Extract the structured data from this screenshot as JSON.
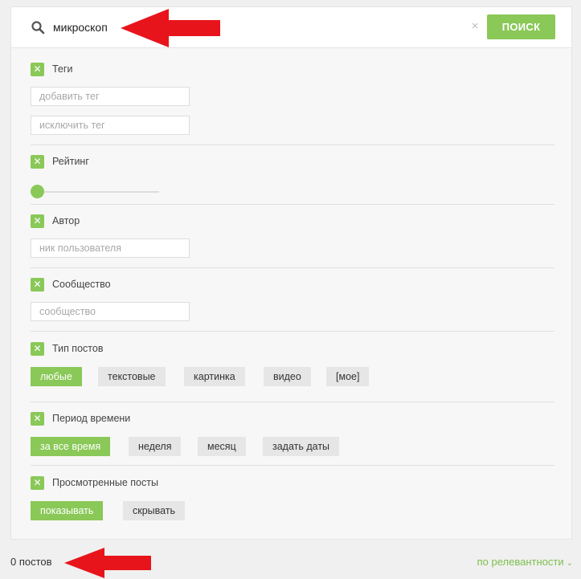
{
  "search": {
    "value": "микроскоп",
    "clear_glyph": "×",
    "button_label": "ПОИСК"
  },
  "filters": {
    "tags": {
      "label": "Теги",
      "include_placeholder": "добавить тег",
      "exclude_placeholder": "исключить тег"
    },
    "rating": {
      "label": "Рейтинг",
      "slider_value": 0
    },
    "author": {
      "label": "Автор",
      "placeholder": "ник пользователя"
    },
    "community": {
      "label": "Сообщество",
      "placeholder": "сообщество"
    },
    "post_type": {
      "label": "Тип постов",
      "options": [
        "любые",
        "текстовые",
        "картинка",
        "видео",
        "[мое]"
      ],
      "selected": "любые"
    },
    "period": {
      "label": "Период времени",
      "options": [
        "за все время",
        "неделя",
        "месяц",
        "задать даты"
      ],
      "selected": "за все время"
    },
    "viewed": {
      "label": "Просмотренные посты",
      "options": [
        "показывать",
        "скрывать"
      ],
      "selected": "показывать"
    }
  },
  "results": {
    "count_label": "0 постов",
    "sort_label": "по релевантности"
  },
  "icons": {
    "search": "search-icon",
    "check": "close-icon",
    "sort_chevron": "chevron-down-icon",
    "arrow": "arrow-left-icon"
  },
  "colors": {
    "accent": "#8ac858",
    "sort_link": "#7cbf4d",
    "annotation_arrow": "#e8141c"
  }
}
